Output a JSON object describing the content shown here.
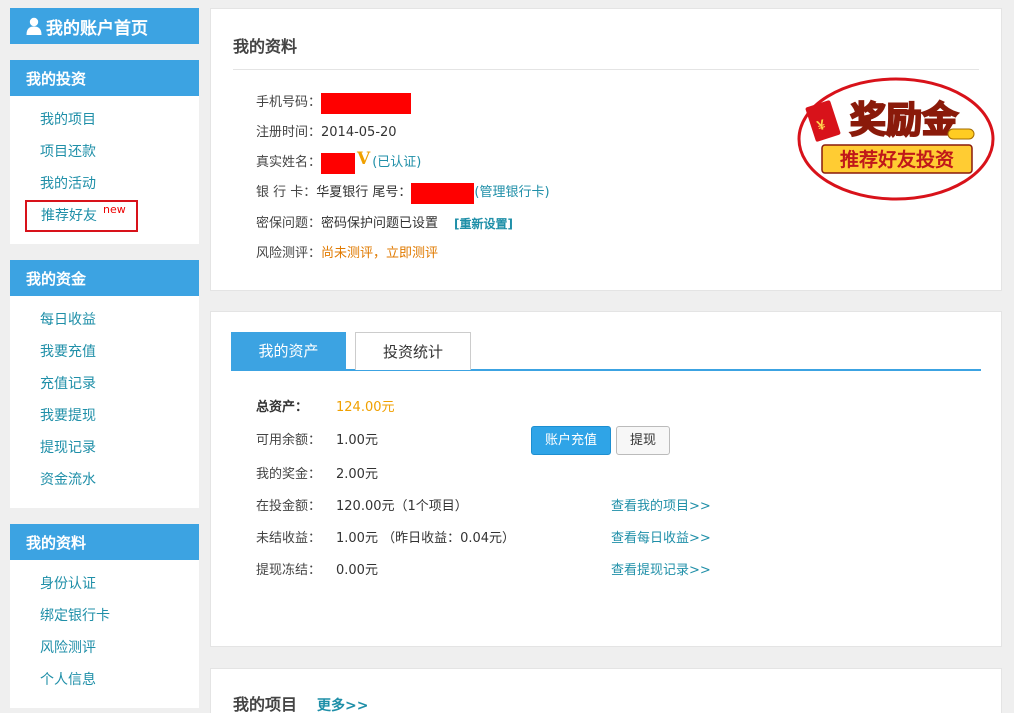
{
  "sidebar": {
    "home_label": "我的账户首页",
    "groups": [
      {
        "title": "我的投资",
        "items": [
          {
            "label": "我的项目"
          },
          {
            "label": "项目还款"
          },
          {
            "label": "我的活动"
          },
          {
            "label": "推荐好友",
            "badge": "new",
            "highlight": true
          }
        ]
      },
      {
        "title": "我的资金",
        "items": [
          {
            "label": "每日收益"
          },
          {
            "label": "我要充值"
          },
          {
            "label": "充值记录"
          },
          {
            "label": "我要提现"
          },
          {
            "label": "提现记录"
          },
          {
            "label": "资金流水"
          }
        ]
      },
      {
        "title": "我的资料",
        "items": [
          {
            "label": "身份认证"
          },
          {
            "label": "绑定银行卡"
          },
          {
            "label": "风险测评"
          },
          {
            "label": "个人信息"
          }
        ]
      }
    ]
  },
  "profile": {
    "title": "我的资料",
    "phone_label": "手机号码：",
    "register_label": "注册时间：",
    "register_date": "2014-05-20",
    "realname_label": "真实姓名：",
    "verified_mark": "V",
    "verified_text": "(已认证)",
    "bank_label": "银 行 卡：",
    "bank_name": "华夏银行 尾号：",
    "bank_manage": "(管理银行卡)",
    "security_label": "密保问题：",
    "security_value": "密码保护问题已设置",
    "security_reset": "[重新设置]",
    "risk_label": "风险测评：",
    "risk_value": "尚未测评，立即测评"
  },
  "reward_badge": {
    "line1": "奖励金",
    "line2": "推荐好友投资",
    "symbol": "¥"
  },
  "assets": {
    "tabs": [
      {
        "label": "我的资产",
        "active": true
      },
      {
        "label": "投资统计",
        "active": false
      }
    ],
    "rows": [
      {
        "label": "总资产：",
        "value": "124.00元",
        "link": ""
      },
      {
        "label": "可用余额：",
        "value": "1.00元",
        "link": ""
      },
      {
        "label": "我的奖金：",
        "value": "2.00元",
        "link": ""
      },
      {
        "label": "在投金额：",
        "value": "120.00元（1个项目）",
        "link": "查看我的项目>>"
      },
      {
        "label": "未结收益：",
        "value": "1.00元 （昨日收益：0.04元）",
        "link": "查看每日收益>>"
      },
      {
        "label": "提现冻结：",
        "value": "0.00元",
        "link": "查看提现记录>>"
      }
    ],
    "recharge_button": "账户充值",
    "withdraw_button": "提现"
  },
  "projects": {
    "title": "我的项目",
    "more": "更多>>"
  },
  "colors": {
    "accent": "#3ca3e2",
    "link": "#1f8fa8",
    "highlight_border": "#d8121a",
    "orange": "#f0a000"
  }
}
